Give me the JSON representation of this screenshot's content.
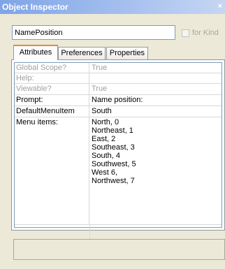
{
  "window": {
    "title": "Object Inspector",
    "close_glyph": "×"
  },
  "name_field": {
    "value": "NamePosition"
  },
  "for_kind": {
    "label": "for Kind",
    "checked": false
  },
  "tabs": [
    {
      "label": "Attributes",
      "active": true
    },
    {
      "label": "Preferences",
      "active": false
    },
    {
      "label": "Properties",
      "active": false
    }
  ],
  "attributes": [
    {
      "name": "Global Scope?",
      "value": "True",
      "enabled": false
    },
    {
      "name": "Help:",
      "value": "",
      "enabled": false
    },
    {
      "name": "Viewable?",
      "value": "True",
      "enabled": false
    },
    {
      "name": "Prompt:",
      "value": "Name position:",
      "enabled": true
    },
    {
      "name": "DefaultMenuItem",
      "value": "South",
      "enabled": true
    },
    {
      "name": "Menu items:",
      "value": "North, 0\nNortheast, 1\nEast, 2\nSoutheast, 3\nSouth, 4\nSouthwest, 5\nWest 6,\nNorthwest, 7",
      "enabled": true
    }
  ],
  "status": {
    "text": ""
  },
  "colors": {
    "titlebar": "#7fa4e6",
    "active_tab_accent": "#e68b2c",
    "disabled_text": "#a0a0a0"
  }
}
